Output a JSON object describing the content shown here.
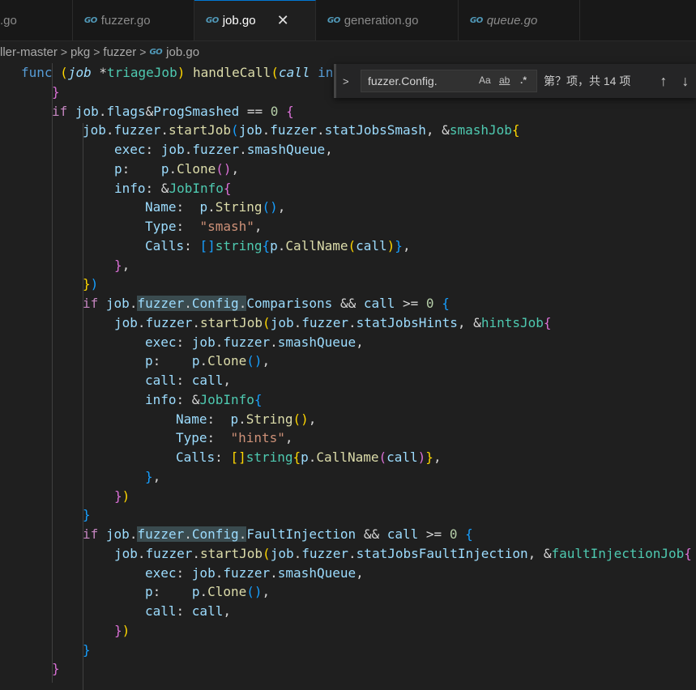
{
  "tabs": [
    {
      "label": ".go"
    },
    {
      "label": "fuzzer.go"
    },
    {
      "label": "job.go",
      "close": "✕"
    },
    {
      "label": "generation.go"
    },
    {
      "label": "queue.go"
    }
  ],
  "breadcrumb": [
    "ller-master",
    "pkg",
    "fuzzer",
    "job.go"
  ],
  "find": {
    "query": "fuzzer.Config.",
    "match_case": "Aa",
    "whole_word": "ab",
    "regex": ".*",
    "result": "第？项，共 14 项"
  },
  "icons": {
    "go": "GO",
    "chevron_right": ">",
    "arrow_up": "↑",
    "arrow_down": "↓",
    "close": "✕"
  }
}
